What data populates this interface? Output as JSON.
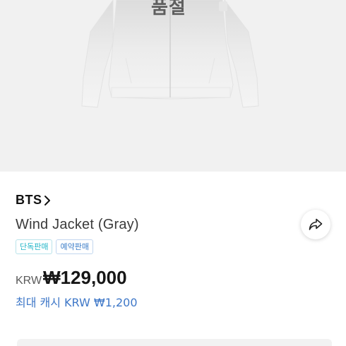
{
  "product_image": {
    "overlay_text": "품절"
  },
  "artist": {
    "name": "BTS"
  },
  "product": {
    "title": "Wind Jacket (Gray)",
    "badges": [
      "단독판매",
      "예약판매"
    ],
    "currency": "KRW",
    "price": "₩129,000",
    "cashback": "최대 캐시 KRW ₩1,200"
  },
  "icons": {
    "artist_chevron": "chevron-right-icon",
    "share": "share-icon"
  },
  "colors": {
    "image_background": "#f1f1f1",
    "badge_exclusive": "#22b5c8",
    "badge_preorder": "#3c7ec9",
    "cashback": "#3f78c8"
  }
}
